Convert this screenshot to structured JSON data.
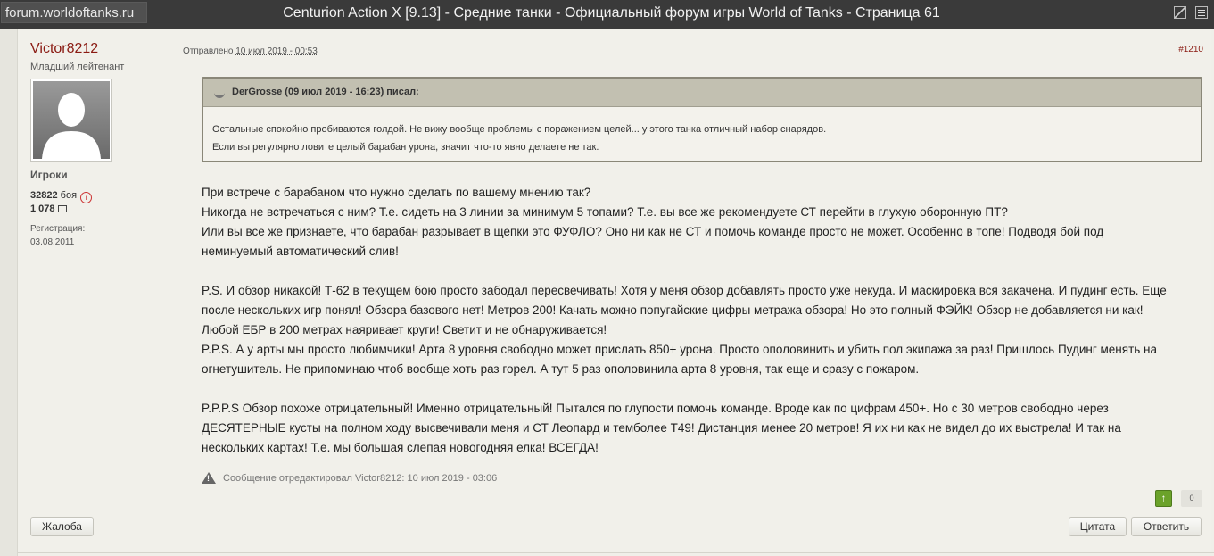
{
  "browser": {
    "url": "forum.worldoftanks.ru",
    "title": "Centurion Action X [9.13] - Средние танки - Официальный форум игры World of Tanks - Страница 61"
  },
  "author": {
    "username": "Victor8212",
    "rank": "Младший лейтенант",
    "group": "Игроки",
    "battles_value": "32822",
    "battles_suffix": "боя",
    "posts_value": "1 078",
    "reg_label": "Регистрация:",
    "reg_date": "03.08.2011"
  },
  "post": {
    "posted_prefix": "Отправлено",
    "posted_date": "10 июл 2019 - 00:53",
    "number": "#1210",
    "quote": {
      "header": "DerGrosse (09 июл 2019 - 16:23) писал:",
      "line1": "Остальные спокойно пробиваются голдой. Не вижу вообще проблемы с поражением целей... у этого танка отличный набор снарядов.",
      "line2": "Если вы регулярно ловите целый барабан урона, значит что-то явно делаете не так."
    },
    "para1": {
      "l1": "При встрече с барабаном что нужно сделать по вашему мнению так?",
      "l2": "Никогда не встречаться с ним? Т.е. сидеть на 3 линии за минимум 5 топами? Т.е. вы все же рекомендуете СТ перейти в глухую оборонную ПТ?",
      "l3": "Или вы все же признаете, что барабан разрывает в щепки это ФУФЛО? Оно ни как не СТ и помочь команде просто не может. Особенно в топе! Подводя бой под",
      "l4": "неминуемый автоматический слив!"
    },
    "para2": {
      "l1": "P.S. И обзор никакой! Т-62 в текущем бою просто забодал пересвечивать! Хотя у меня обзор добавлять просто уже некуда. И маскировка вся закачена. И пудинг есть. Еще",
      "l2": "после нескольких игр понял! Обзора базового нет! Метров 200! Качать можно попугайские цифры метража обзора! Но это полный ФЭЙК! Обзор не добавляется ни как!",
      "l3": "Любой ЕБР в 200 метрах наяривает круги! Светит и не обнаруживается!",
      "l4": "P.P.S. А у арты мы просто любимчики! Арта 8 уровня свободно может прислать 850+ урона. Просто ополовинить и убить пол экипажа за раз! Пришлось Пудинг менять на",
      "l5": "огнетушитель. Не припоминаю чтоб вообще хоть раз горел. А тут 5 раз ополовинила арта 8 уровня, так еще и сразу с пожаром."
    },
    "para3": {
      "l1": "P.P.P.S Обзор похоже отрицательный! Именно отрицательный! Пытался по глупости помочь команде. Вроде как по цифрам 450+. Но с 30 метров свободно через",
      "l2": "ДЕСЯТЕРНЫЕ кусты на полном ходу высвечивали меня и СТ Леопард и темболее Т49! Дистанция менее 20 метров! Я их ни как не видел до их выстрела! И так на",
      "l3": "нескольких картах! Т.е. мы большая слепая новогодняя елка! ВСЕГДА!"
    },
    "edited": "Сообщение отредактировал Victor8212: 10 июл 2019 - 03:06",
    "rep_count": "0"
  },
  "buttons": {
    "report": "Жалоба",
    "quote": "Цитата",
    "reply": "Ответить"
  },
  "colors": {
    "username": "#8a1a12",
    "quote_border": "#8a8778",
    "plus_green": "#6ba22a"
  }
}
